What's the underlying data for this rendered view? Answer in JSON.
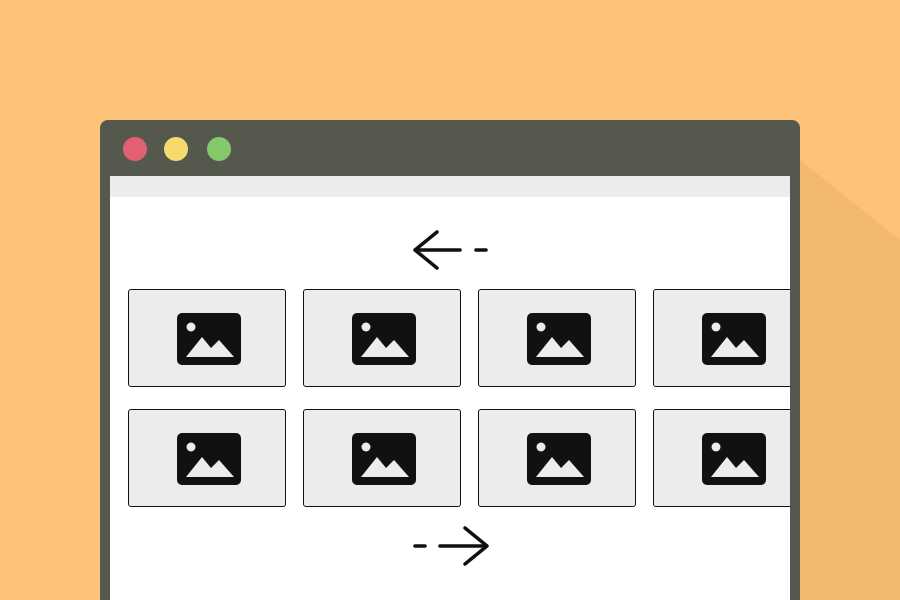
{
  "colors": {
    "background": "#fec279",
    "window_frame": "#55594d",
    "close": "#e36074",
    "minimize": "#f4db6c",
    "maximize": "#85c96b",
    "tile_fill": "#edebec",
    "icon": "#111111"
  },
  "window": {
    "controls": [
      "close",
      "minimize",
      "maximize"
    ]
  },
  "gallery": {
    "rows": 2,
    "columns_visible": 4,
    "tile_icon": "image-icon",
    "nav": {
      "previous_icon": "arrow-left-icon",
      "next_icon": "arrow-right-icon"
    }
  }
}
